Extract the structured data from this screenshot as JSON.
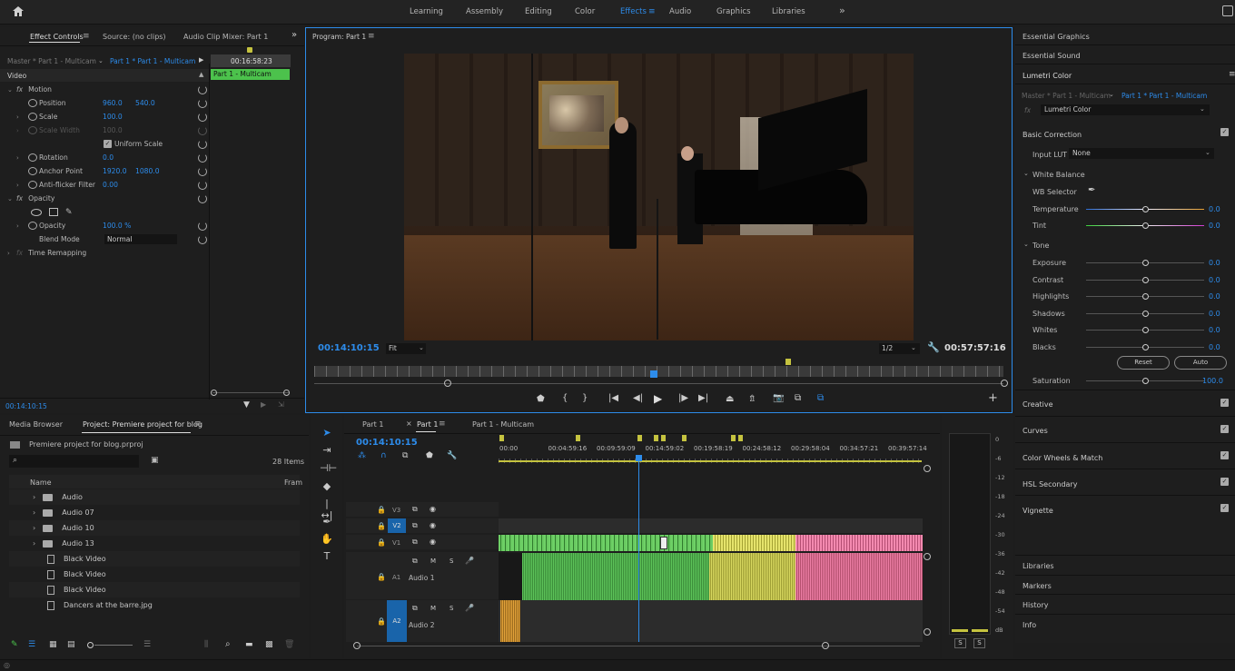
{
  "workspaces": [
    "Learning",
    "Assembly",
    "Editing",
    "Color",
    "Effects",
    "Audio",
    "Graphics",
    "Libraries"
  ],
  "active_workspace": "Effects",
  "more_icon": "»",
  "effect_controls": {
    "tabs": [
      "Effect Controls",
      "Source: (no clips)",
      "Audio Clip Mixer: Part 1"
    ],
    "master_label": "Master * Part 1 - Multicam",
    "sequence_label": "Part 1 * Part 1 - Multicam",
    "timecode_top": "00:16:58:23",
    "clip_name": "Part 1 - Multicam",
    "section_video": "Video",
    "motion": "Motion",
    "position_label": "Position",
    "position_x": "960.0",
    "position_y": "540.0",
    "scale_label": "Scale",
    "scale_value": "100.0",
    "scale_width_label": "Scale Width",
    "scale_width_value": "100.0",
    "uniform_scale": "Uniform Scale",
    "rotation_label": "Rotation",
    "rotation_value": "0.0",
    "anchor_label": "Anchor Point",
    "anchor_x": "1920.0",
    "anchor_y": "1080.0",
    "antiflicker_label": "Anti-flicker Filter",
    "antiflicker_value": "0.00",
    "opacity_section": "Opacity",
    "opacity_label": "Opacity",
    "opacity_value": "100.0 %",
    "blend_label": "Blend Mode",
    "blend_value": "Normal",
    "time_remap": "Time Remapping",
    "bottom_timecode": "00:14:10:15"
  },
  "program": {
    "title": "Program: Part 1",
    "timecode": "00:14:10:15",
    "fit": "Fit",
    "resolution": "1/2",
    "duration": "00:57:57:16"
  },
  "right_panel": {
    "items_top": [
      "Essential Graphics",
      "Essential Sound",
      "Lumetri Color"
    ],
    "master_label": "Master * Part 1 - Multicam",
    "seq_label": "Part 1 * Part 1 - Multicam",
    "fx_label": "Lumetri Color",
    "basic_correction": "Basic Correction",
    "input_lut_label": "Input LUT",
    "input_lut_value": "None",
    "white_balance": "White Balance",
    "wb_selector": "WB Selector",
    "temperature": "Temperature",
    "temperature_value": "0.0",
    "tint": "Tint",
    "tint_value": "0.0",
    "tone": "Tone",
    "tone_rows": [
      {
        "label": "Exposure",
        "value": "0.0"
      },
      {
        "label": "Contrast",
        "value": "0.0"
      },
      {
        "label": "Highlights",
        "value": "0.0"
      },
      {
        "label": "Shadows",
        "value": "0.0"
      },
      {
        "label": "Whites",
        "value": "0.0"
      },
      {
        "label": "Blacks",
        "value": "0.0"
      }
    ],
    "reset": "Reset",
    "auto": "Auto",
    "saturation": "Saturation",
    "saturation_value": "100.0",
    "sections": [
      "Creative",
      "Curves",
      "Color Wheels & Match",
      "HSL Secondary",
      "Vignette"
    ],
    "items_bottom": [
      "Libraries",
      "Markers",
      "History",
      "Info"
    ]
  },
  "project": {
    "tabs": [
      "Media Browser",
      "Project: Premiere project for blog"
    ],
    "file": "Premiere project for blog.prproj",
    "item_count": "28 Items",
    "col_name": "Name",
    "col_frame": "Fram",
    "items": [
      {
        "name": "Audio",
        "type": "folder"
      },
      {
        "name": "Audio 07",
        "type": "folder"
      },
      {
        "name": "Audio 10",
        "type": "folder"
      },
      {
        "name": "Audio 13",
        "type": "folder"
      },
      {
        "name": "Black Video",
        "type": "file"
      },
      {
        "name": "Black Video",
        "type": "file"
      },
      {
        "name": "Black Video",
        "type": "file"
      },
      {
        "name": "Dancers at the barre.jpg",
        "type": "file"
      }
    ]
  },
  "timeline": {
    "tabs": [
      "Part 1",
      "Part 1",
      "Part 1 - Multicam"
    ],
    "timecode": "00:14:10:15",
    "ruler": [
      "00:00",
      "00:04:59:16",
      "00:09:59:09",
      "00:14:59:02",
      "00:19:58:19",
      "00:24:58:12",
      "00:29:58:04",
      "00:34:57:21",
      "00:39:57:14"
    ],
    "tracks": {
      "v3": "V3",
      "v2": "V2",
      "v1": "V1",
      "a1": "A1",
      "a2": "A2",
      "audio1": "Audio 1",
      "audio2": "Audio 2",
      "m": "M",
      "s": "S"
    }
  },
  "meter": {
    "scale": [
      "0",
      "-6",
      "-12",
      "-18",
      "-24",
      "-30",
      "-36",
      "-42",
      "-48",
      "-54",
      "dB"
    ],
    "solo": "S"
  }
}
